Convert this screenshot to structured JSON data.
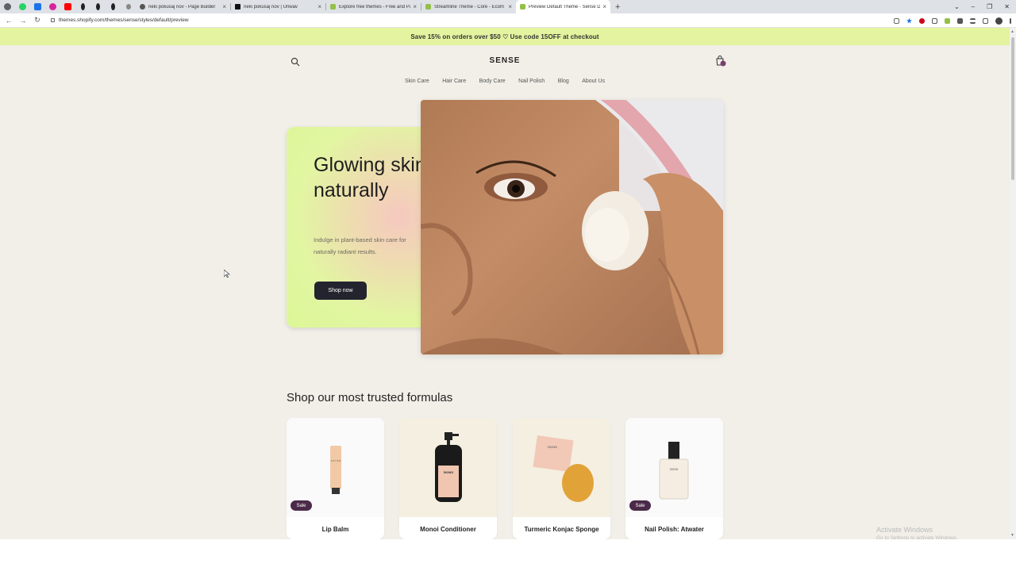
{
  "browser": {
    "pinned_tabs": [
      {
        "icon": "chrome-icon",
        "color": "#5f6368"
      },
      {
        "icon": "whatsapp-icon",
        "color": "#25d366"
      },
      {
        "icon": "ext-icon",
        "color": "#1a73e8"
      },
      {
        "icon": "instagram-icon",
        "color": "#d6249f"
      },
      {
        "icon": "youtube-icon",
        "color": "#ff0000"
      },
      {
        "icon": "bolt-icon",
        "color": "#222222"
      },
      {
        "icon": "bolt-icon",
        "color": "#222222"
      },
      {
        "icon": "bolt-icon",
        "color": "#222222"
      },
      {
        "icon": "apple-icon",
        "color": "#555555"
      }
    ],
    "tabs": [
      {
        "title": "neki pokusaj nov - Page Builder",
        "fav_color": "#333333",
        "active": false
      },
      {
        "title": "neki pokusaj nov | Unwav",
        "fav_color": "#111111",
        "active": false
      },
      {
        "title": "Explore free themes - Free and Pa",
        "fav_color": "#95bf47",
        "active": false
      },
      {
        "title": "Streamline Theme - Core - Ecom",
        "fav_color": "#95bf47",
        "active": false
      },
      {
        "title": "Preview Default Theme - Sense D",
        "fav_color": "#95bf47",
        "active": true
      }
    ],
    "url": "themes.shopify.com/themes/sense/styles/default/preview"
  },
  "announcement": "Save 15% on orders over $50 ♡ Use code 15OFF at checkout",
  "header": {
    "logo": "SENSE",
    "nav": [
      "Skin Care",
      "Hair Care",
      "Body Care",
      "Nail Polish",
      "Blog",
      "About Us"
    ]
  },
  "hero": {
    "title": "Glowing skin, naturally",
    "subtitle": "Indulge in plant-based skin care for naturally radiant results.",
    "button": "Shop now"
  },
  "collection": {
    "title": "Shop our most trusted formulas",
    "products": [
      {
        "name": "Lip Balm",
        "badge": "Sale"
      },
      {
        "name": "Monoi Conditioner",
        "badge": ""
      },
      {
        "name": "Turmeric Konjac Sponge",
        "badge": ""
      },
      {
        "name": "Nail Polish: Atwater",
        "badge": "Sale"
      }
    ]
  },
  "os_watermark": {
    "line1": "Activate Windows",
    "line2": "Go to Settings to activate Windows."
  },
  "colors": {
    "announcement_bg": "#e3f3a0",
    "button_bg": "#24242e",
    "badge_bg": "#4a2a48",
    "page_bg": "#f1efe8"
  }
}
